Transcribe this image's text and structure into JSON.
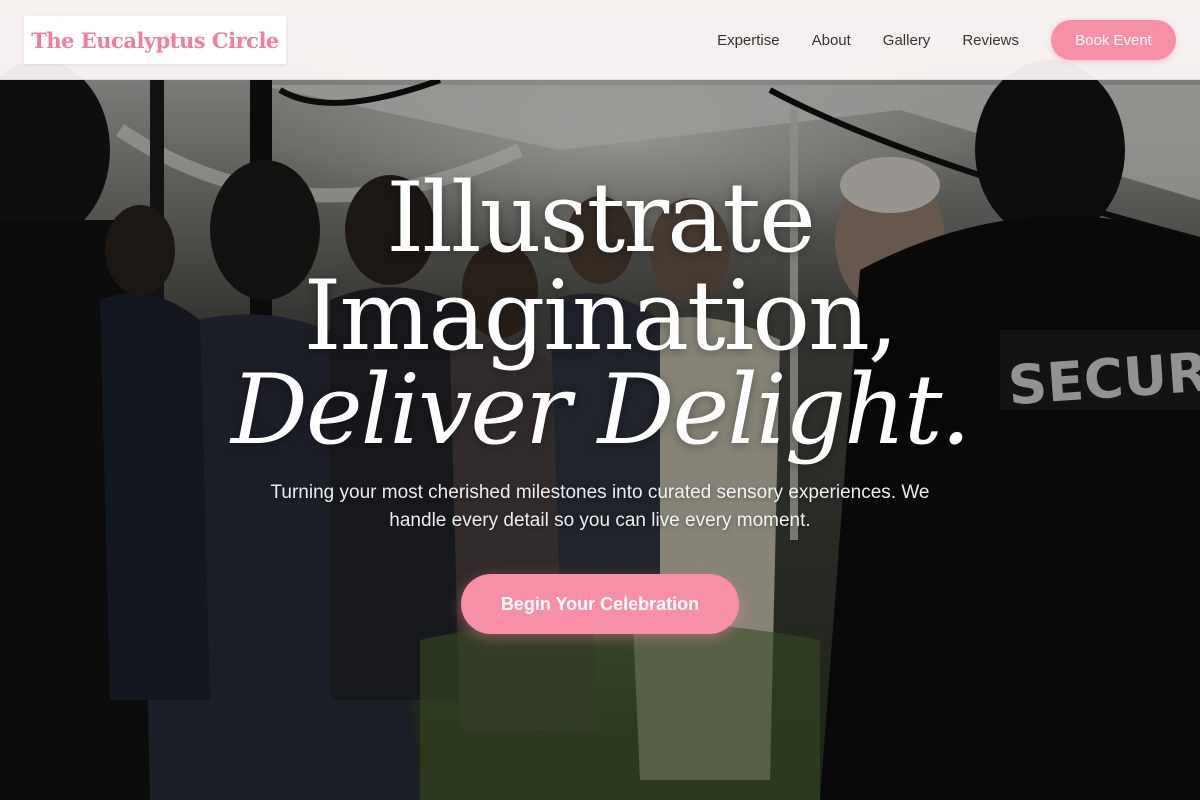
{
  "brand": {
    "name": "The Eucalyptus Circle"
  },
  "nav": {
    "items": [
      {
        "label": "Expertise"
      },
      {
        "label": "About"
      },
      {
        "label": "Gallery"
      },
      {
        "label": "Reviews"
      }
    ],
    "cta_label": "Book Event"
  },
  "hero": {
    "line1": "Illustrate",
    "line2": "Imagination,",
    "line3": "Deliver Delight.",
    "subtitle": "Turning your most cherished milestones into curated sensory experiences. We handle every detail so you can live every moment.",
    "cta_label": "Begin Your Celebration",
    "image_description": "outdoor tented event crowd",
    "visible_text_in_image": "SECURIT"
  },
  "colors": {
    "accent": "#f78fa7",
    "brand_text": "#ef7f9b",
    "header_bg": "#fdf6f7",
    "nav_text": "#3a3330",
    "hero_text": "#ffffff"
  }
}
